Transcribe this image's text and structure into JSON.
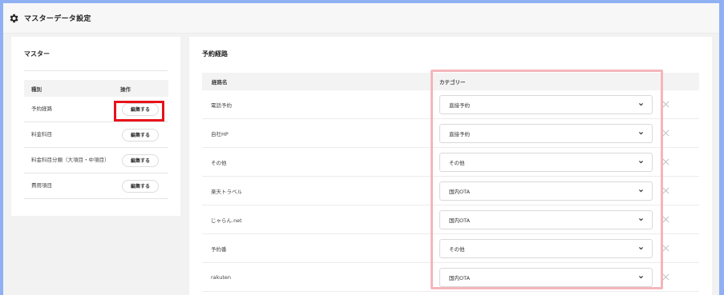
{
  "header": {
    "title": "マスターデータ設定",
    "icon": "gear-icon"
  },
  "master": {
    "title": "マスター",
    "col_kind": "種別",
    "col_action": "操作",
    "rows": [
      {
        "label": "予約経路",
        "button": "編集する"
      },
      {
        "label": "料金科目",
        "button": "編集する"
      },
      {
        "label": "料金科目分類（大項目・中項目）",
        "button": "編集する"
      },
      {
        "label": "費用項目",
        "button": "編集する"
      }
    ]
  },
  "routes": {
    "title": "予約経路",
    "col_name": "経路名",
    "col_category": "カテゴリー",
    "rows": [
      {
        "name": "電話予約",
        "category": "直接予約"
      },
      {
        "name": "自社HP",
        "category": "直接予約"
      },
      {
        "name": "その他",
        "category": "その他"
      },
      {
        "name": "楽天トラベル",
        "category": "国内OTA"
      },
      {
        "name": "じゃらん.net",
        "category": "国内OTA"
      },
      {
        "name": "予約番",
        "category": "その他"
      },
      {
        "name": "rakuten",
        "category": "国内OTA"
      }
    ]
  },
  "colors": {
    "highlight_red": "#e8121a",
    "highlight_pink": "#f4b6bc",
    "frame": "#8fb0f2"
  }
}
